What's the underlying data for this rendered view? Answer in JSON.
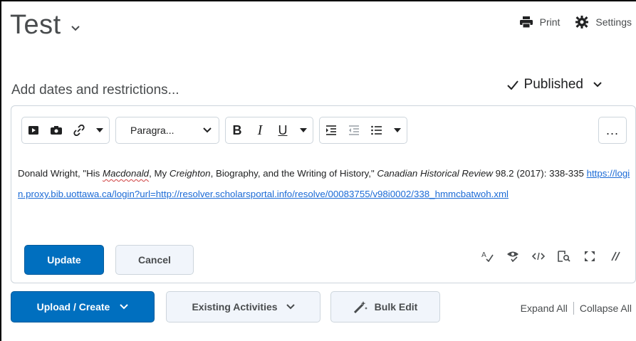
{
  "header": {
    "title": "Test",
    "print_label": "Print",
    "settings_label": "Settings"
  },
  "dates_link": "Add dates and restrictions...",
  "status": {
    "label": "Published"
  },
  "editor": {
    "format_select": "Paragra...",
    "bold": "B",
    "italic": "I",
    "underline": "U",
    "more": "...",
    "content": {
      "p1": "Donald Wright, \"His ",
      "p1_em1": "Macdonald",
      "p2": ", My ",
      "p2_em": "Creighton",
      "p3": ", Biography, and the Writing of History,\" ",
      "p3_em": "Canadian Historical Review",
      "p4": " 98.2 (2017): 338-335 ",
      "link": "https://login.proxy.bib.uottawa.ca/login?url=http://resolver.scholarsportal.info/resolve/00083755/v98i0002/338_hmmcbatwoh.xml"
    },
    "update_label": "Update",
    "cancel_label": "Cancel"
  },
  "bottom": {
    "upload_label": "Upload / Create",
    "existing_label": "Existing Activities",
    "bulk_label": "Bulk Edit",
    "expand_label": "Expand All",
    "collapse_label": "Collapse All"
  },
  "colors": {
    "primary": "#006fbf",
    "link": "#1a6ad6",
    "text": "#494c4e",
    "border": "#cdd5dc"
  }
}
